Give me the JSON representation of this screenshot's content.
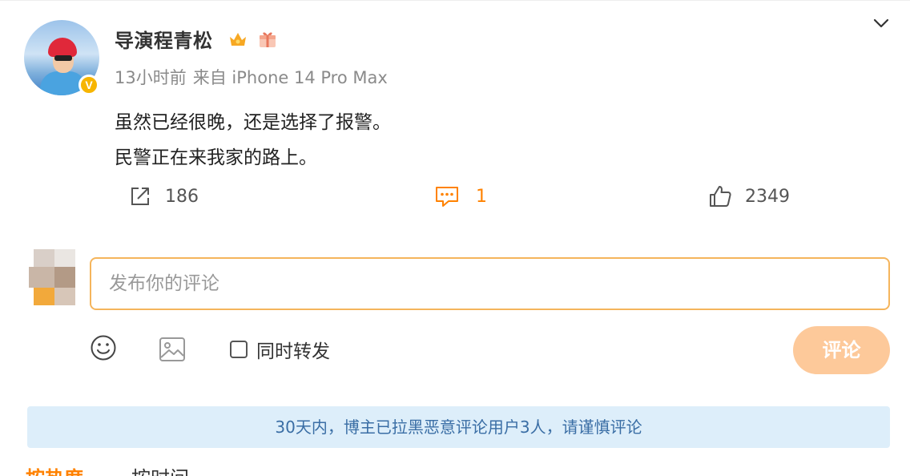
{
  "post": {
    "author": "导演程青松",
    "verified_mark": "V",
    "time": "13小时前",
    "source": "来自 iPhone 14 Pro Max",
    "lines": [
      "虽然已经很晚，还是选择了报警。",
      "民警正在来我家的路上。"
    ]
  },
  "actions": {
    "share_count": "186",
    "comment_count": "1",
    "like_count": "2349"
  },
  "composer": {
    "placeholder": "发布你的评论",
    "forward_label": "同时转发",
    "submit_label": "评论"
  },
  "notice": "30天内，博主已拉黑恶意评论用户3人，请谨慎评论",
  "sort_tabs": [
    "按热度",
    "按时间"
  ],
  "icons": [
    "crown-icon",
    "gift-icon",
    "chevron-down-icon",
    "share-icon",
    "comment-icon",
    "like-icon",
    "emoji-icon",
    "image-icon"
  ],
  "colors": {
    "accent": "#ff8200",
    "input_border": "#f5b55c",
    "submit_bg": "#fdc99a",
    "notice_bg": "#ddeefa",
    "notice_text": "#3a6ea5"
  }
}
